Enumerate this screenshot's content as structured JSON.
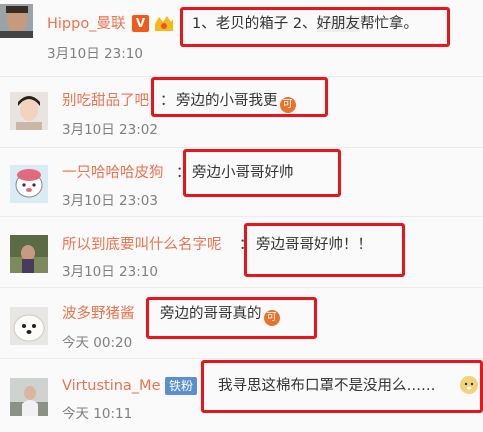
{
  "comments": [
    {
      "name": "Hippo_曼联",
      "text_pre": "1、老贝的箱子 2、",
      "text_mid": "好朋友",
      "text_post": "帮忙拿。",
      "time": "3月10日 23:10",
      "badge": "V"
    },
    {
      "name": "别吃甜品了吧",
      "sep": "：",
      "text": "旁边的小哥我更",
      "time": "3月10日 23:02",
      "emoji": "可"
    },
    {
      "name": "一只哈哈哈皮狗",
      "sep": "：",
      "text": "旁边小哥哥好帅",
      "time": "3月10日 23:03"
    },
    {
      "name": "所以到底要叫什么名字呢",
      "sep": "：",
      "text": "旁边哥哥好帅！！",
      "time": "3月10日 23:10"
    },
    {
      "name": "波多野猪酱",
      "sep": "：",
      "text": "旁边的哥哥真的",
      "time": "今天 00:20",
      "emoji": "可"
    },
    {
      "name": "Virtustina_Me",
      "badge": "铁粉",
      "text": "我寻思这棉布口罩不是没用么……",
      "time": "今天 10:11"
    }
  ]
}
